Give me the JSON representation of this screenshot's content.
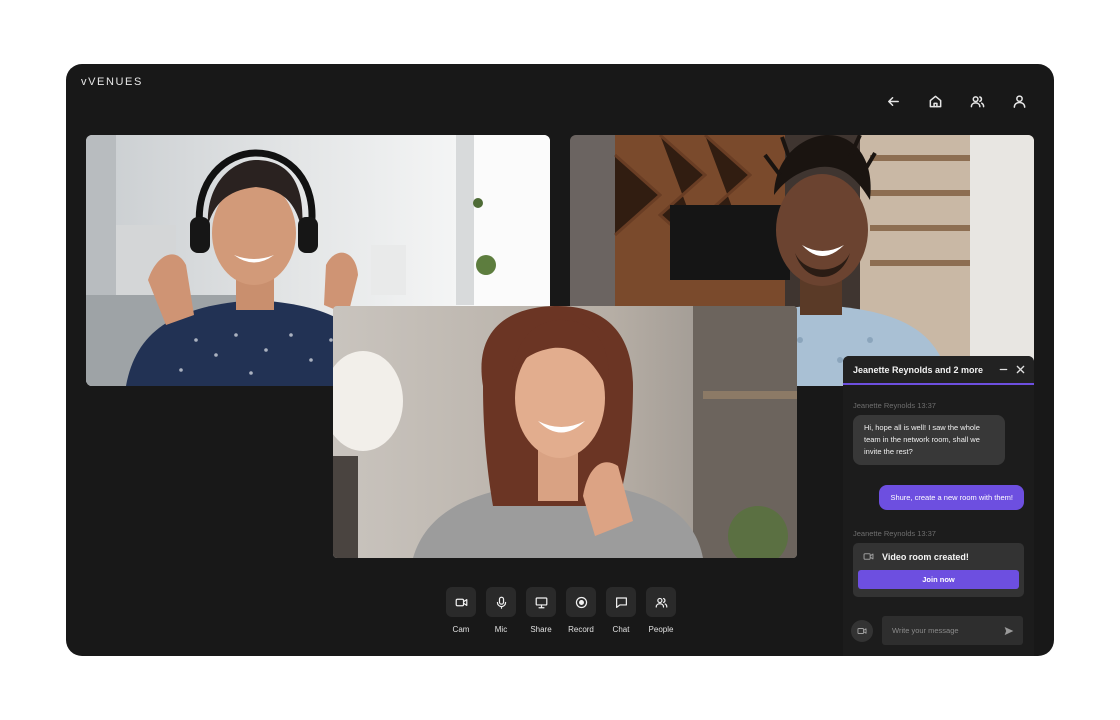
{
  "app": {
    "logo": "vVENUES"
  },
  "nav": {
    "icons": [
      "back-arrow-icon",
      "home-icon",
      "people-icon",
      "profile-icon"
    ]
  },
  "participants": [
    {
      "name": "participant-1",
      "description": "woman with headphones"
    },
    {
      "name": "participant-2",
      "description": "man with dreadlocks"
    },
    {
      "name": "participant-3",
      "description": "woman with auburn hair"
    }
  ],
  "controls": [
    {
      "label": "Cam",
      "icon": "camera-icon"
    },
    {
      "label": "Mic",
      "icon": "microphone-icon"
    },
    {
      "label": "Share",
      "icon": "monitor-icon"
    },
    {
      "label": "Record",
      "icon": "record-icon"
    },
    {
      "label": "Chat",
      "icon": "chat-icon"
    },
    {
      "label": "People",
      "icon": "people-icon"
    }
  ],
  "chat": {
    "title": "Jeanette Reynolds and 2 more",
    "messages": [
      {
        "meta": "Jeanette Reynolds 13:37",
        "text": "Hi, hope all is well! I saw the whole team in the network room, shall we invite the rest?"
      },
      {
        "text": "Shure, create a new room with them!"
      },
      {
        "meta": "Jeanette Reynolds 13:37",
        "card_title": "Video room created!",
        "button": "Join now"
      }
    ],
    "input": {
      "placeholder": "Write your message",
      "value": ""
    },
    "colors": {
      "accent": "#6d4fe0",
      "panel": "#1c1c1c"
    }
  }
}
